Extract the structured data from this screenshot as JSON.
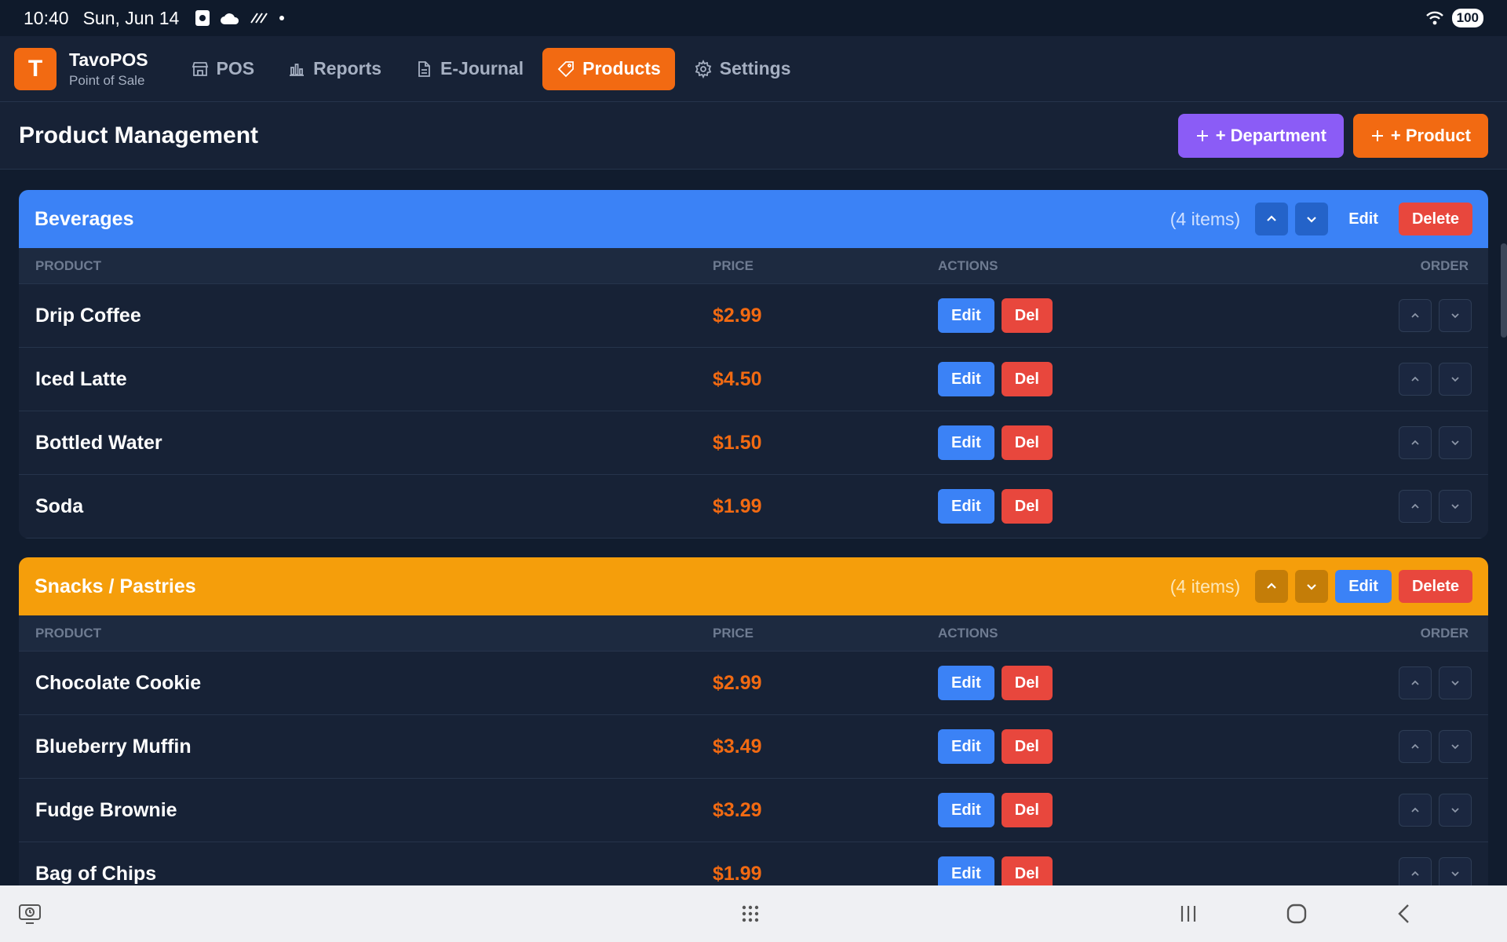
{
  "status": {
    "time": "10:40",
    "date": "Sun, Jun 14",
    "battery": "100"
  },
  "app": {
    "logo_letter": "T",
    "name": "TavoPOS",
    "subtitle": "Point of Sale"
  },
  "nav": [
    {
      "label": "POS",
      "icon": "store-icon"
    },
    {
      "label": "Reports",
      "icon": "bar-chart-icon"
    },
    {
      "label": "E-Journal",
      "icon": "document-icon"
    },
    {
      "label": "Products",
      "icon": "tag-icon",
      "active": true
    },
    {
      "label": "Settings",
      "icon": "gear-icon"
    }
  ],
  "page": {
    "title": "Product Management",
    "add_department": "+ Department",
    "add_product": "+ Product"
  },
  "columns": {
    "product": "PRODUCT",
    "price": "PRICE",
    "actions": "ACTIONS",
    "order": "ORDER"
  },
  "row_actions": {
    "edit": "Edit",
    "delete": "Del"
  },
  "departments": [
    {
      "name": "Beverages",
      "count": "(4 items)",
      "color": "#3b82f6",
      "edit": "Edit",
      "delete": "Delete",
      "products": [
        {
          "name": "Drip Coffee",
          "price": "$2.99"
        },
        {
          "name": "Iced Latte",
          "price": "$4.50"
        },
        {
          "name": "Bottled Water",
          "price": "$1.50"
        },
        {
          "name": "Soda",
          "price": "$1.99"
        }
      ]
    },
    {
      "name": "Snacks / Pastries",
      "count": "(4 items)",
      "color": "#f59e0b",
      "edit": "Edit",
      "delete": "Delete",
      "products": [
        {
          "name": "Chocolate Cookie",
          "price": "$2.99"
        },
        {
          "name": "Blueberry Muffin",
          "price": "$3.49"
        },
        {
          "name": "Fudge Brownie",
          "price": "$3.29"
        },
        {
          "name": "Bag of Chips",
          "price": "$1.99"
        }
      ]
    }
  ],
  "colors": {
    "accent": "#f26a12",
    "department_button": "#8b5cf6",
    "edit": "#3b82f6",
    "delete": "#e8473d",
    "background": "#111c2e"
  }
}
